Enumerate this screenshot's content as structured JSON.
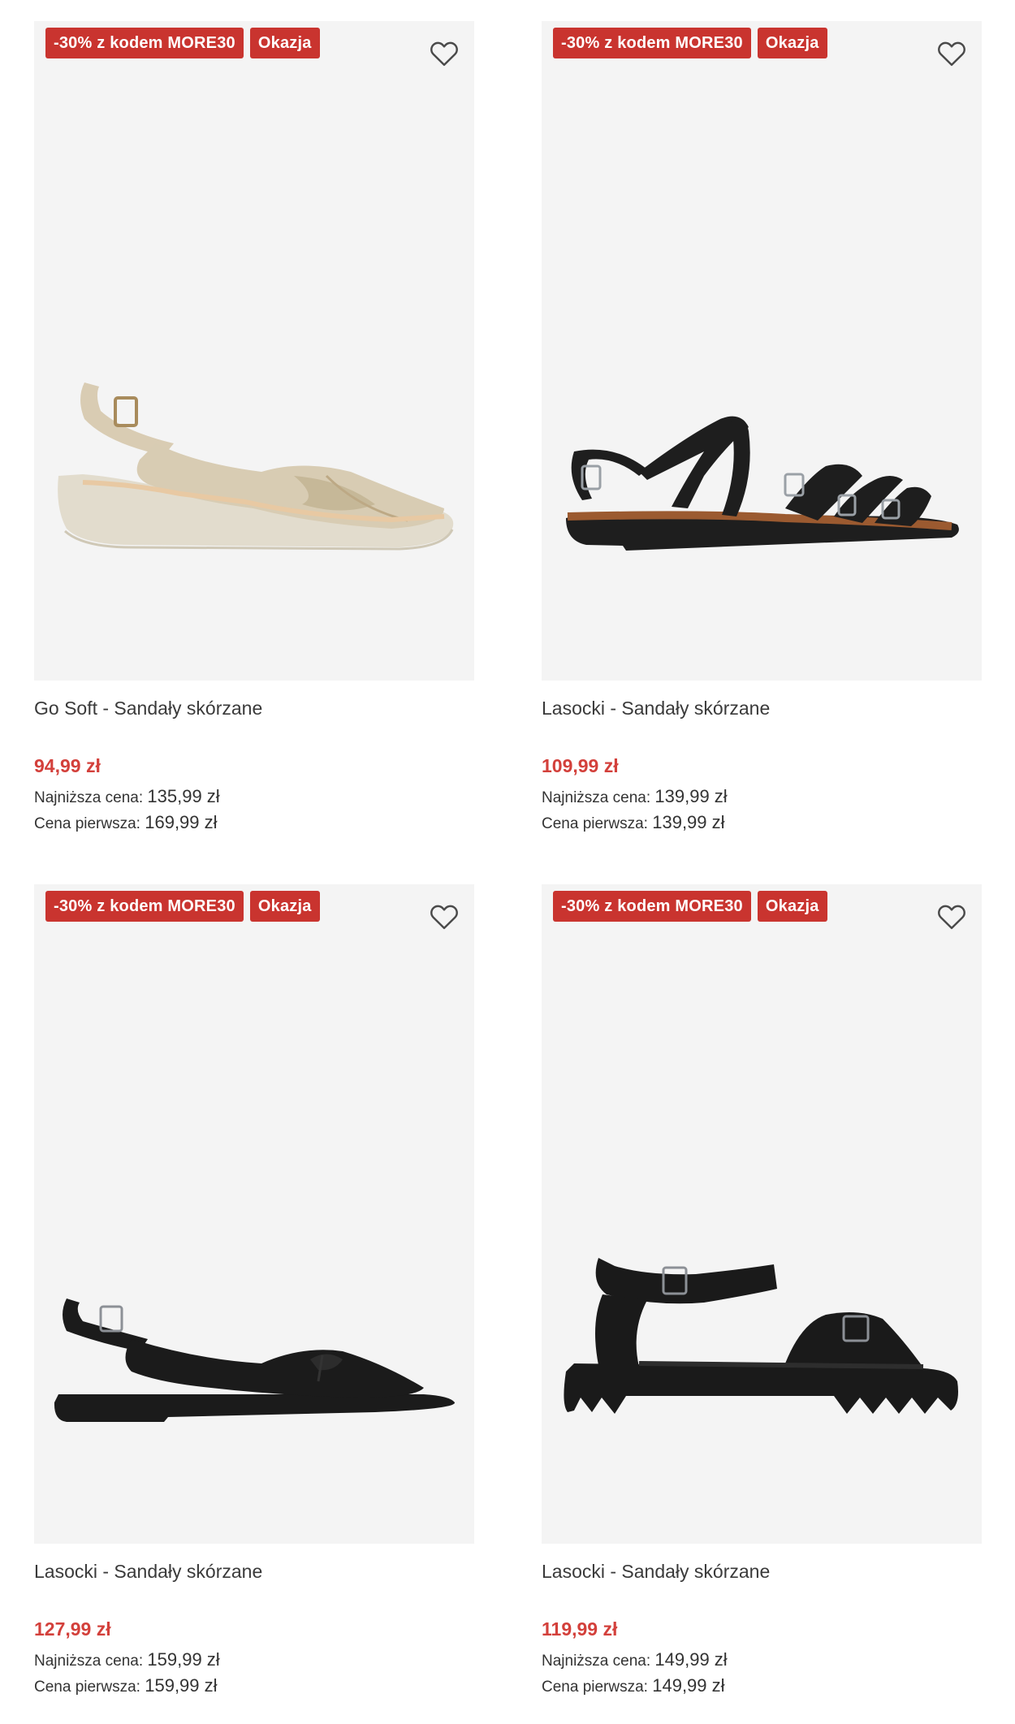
{
  "colors": {
    "badge": "#c9342f",
    "price": "#d3403b",
    "image_bg": "#f4f4f4"
  },
  "products": [
    {
      "badges": [
        "-30% z kodem MORE30",
        "Okazja"
      ],
      "name": "Go Soft - Sandały skórzane",
      "price": "94,99 zł",
      "lowest_label": "Najniższa cena:",
      "lowest_value": "135,99 zł",
      "first_label": "Cena pierwsza:",
      "first_value": "169,99 zł",
      "icon": "heart-icon"
    },
    {
      "badges": [
        "-30% z kodem MORE30",
        "Okazja"
      ],
      "name": "Lasocki - Sandały skórzane",
      "price": "109,99 zł",
      "lowest_label": "Najniższa cena:",
      "lowest_value": "139,99 zł",
      "first_label": "Cena pierwsza:",
      "first_value": "139,99 zł",
      "icon": "heart-icon"
    },
    {
      "badges": [
        "-30% z kodem MORE30",
        "Okazja"
      ],
      "name": "Lasocki - Sandały skórzane",
      "price": "127,99 zł",
      "lowest_label": "Najniższa cena:",
      "lowest_value": "159,99 zł",
      "first_label": "Cena pierwsza:",
      "first_value": "159,99 zł",
      "icon": "heart-icon"
    },
    {
      "badges": [
        "-30% z kodem MORE30",
        "Okazja"
      ],
      "name": "Lasocki - Sandały skórzane",
      "price": "119,99 zł",
      "lowest_label": "Najniższa cena:",
      "lowest_value": "149,99 zł",
      "first_label": "Cena pierwsza:",
      "first_value": "149,99 zł",
      "icon": "heart-icon"
    }
  ]
}
